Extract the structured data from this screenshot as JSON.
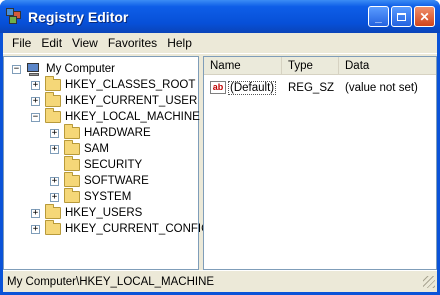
{
  "window": {
    "title": "Registry Editor"
  },
  "menubar": {
    "items": [
      "File",
      "Edit",
      "View",
      "Favorites",
      "Help"
    ]
  },
  "tree": {
    "root": "My Computer",
    "nodes": [
      {
        "label": "HKEY_CLASSES_ROOT",
        "expander": "+"
      },
      {
        "label": "HKEY_CURRENT_USER",
        "expander": "+"
      },
      {
        "label": "HKEY_LOCAL_MACHINE",
        "expander": "−"
      },
      {
        "label": "HARDWARE",
        "expander": "+"
      },
      {
        "label": "SAM",
        "expander": "+"
      },
      {
        "label": "SECURITY",
        "expander": ""
      },
      {
        "label": "SOFTWARE",
        "expander": "+"
      },
      {
        "label": "SYSTEM",
        "expander": "+"
      },
      {
        "label": "HKEY_USERS",
        "expander": "+"
      },
      {
        "label": "HKEY_CURRENT_CONFIG",
        "expander": "+"
      }
    ],
    "root_expander": "−"
  },
  "list": {
    "columns": [
      "Name",
      "Type",
      "Data"
    ],
    "rows": [
      {
        "name": "(Default)",
        "type": "REG_SZ",
        "data": "(value not set)",
        "icon_text": "ab"
      }
    ]
  },
  "statusbar": {
    "path": "My Computer\\HKEY_LOCAL_MACHINE"
  }
}
